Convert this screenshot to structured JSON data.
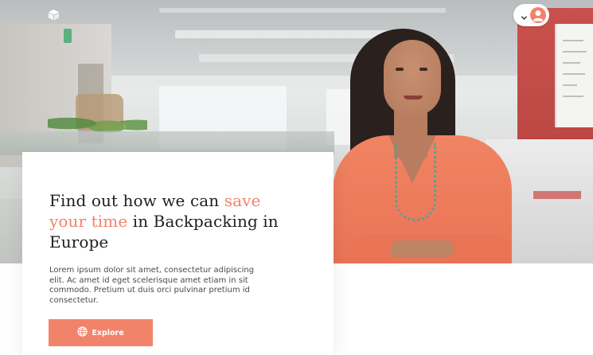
{
  "header": {
    "logo_icon": "cube-icon",
    "account_menu": {
      "chevron_icon": "chevron-down-icon",
      "avatar_icon": "user-avatar-icon"
    }
  },
  "hero": {
    "headline_part1": "Find out how we can ",
    "headline_accent": "save your time",
    "headline_part2": " in Backpacking in Europe",
    "body": "Lorem ipsum dolor sit amet, consectetur adipiscing elit. Ac amet id eget scelerisque amet etiam in sit commodo. Pretium ut duis orci pulvinar pretium id consectetur.",
    "cta_label": "Explore",
    "cta_icon": "globe-icon"
  },
  "colors": {
    "accent": "#f2836b",
    "text_dark": "#1f1f1f",
    "text_body": "#4a4a4a",
    "card_bg": "#ffffff"
  }
}
